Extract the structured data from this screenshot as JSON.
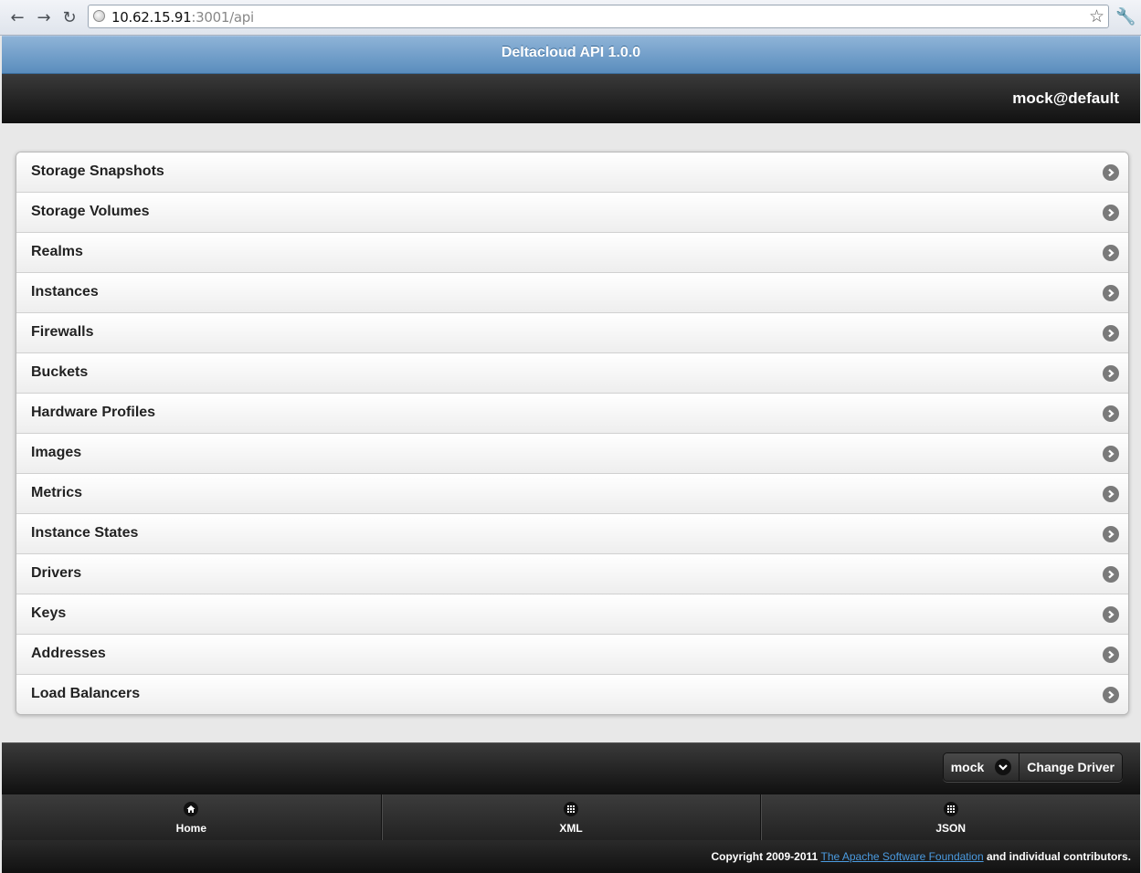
{
  "browser": {
    "url_host": "10.62.15.91",
    "url_path": ":3001/api"
  },
  "header": {
    "title": "Deltacloud API 1.0.0",
    "user": "mock@default"
  },
  "collections": [
    {
      "label": "Storage Snapshots"
    },
    {
      "label": "Storage Volumes"
    },
    {
      "label": "Realms"
    },
    {
      "label": "Instances"
    },
    {
      "label": "Firewalls"
    },
    {
      "label": "Buckets"
    },
    {
      "label": "Hardware Profiles"
    },
    {
      "label": "Images"
    },
    {
      "label": "Metrics"
    },
    {
      "label": "Instance States"
    },
    {
      "label": "Drivers"
    },
    {
      "label": "Keys"
    },
    {
      "label": "Addresses"
    },
    {
      "label": "Load Balancers"
    }
  ],
  "footer": {
    "driver_value": "mock",
    "change_driver_label": "Change Driver",
    "tabs": [
      {
        "label": "Home",
        "icon": "home-icon"
      },
      {
        "label": "XML",
        "icon": "grid-icon"
      },
      {
        "label": "JSON",
        "icon": "grid-icon"
      }
    ],
    "copyright_prefix": "Copyright 2009-2011",
    "copyright_link": "The Apache Software Foundation",
    "copyright_suffix": "and individual contributors."
  },
  "colors": {
    "header_blue": "#6f9ccb",
    "bar_dark": "#1a1a1a",
    "link": "#4b9be0"
  }
}
